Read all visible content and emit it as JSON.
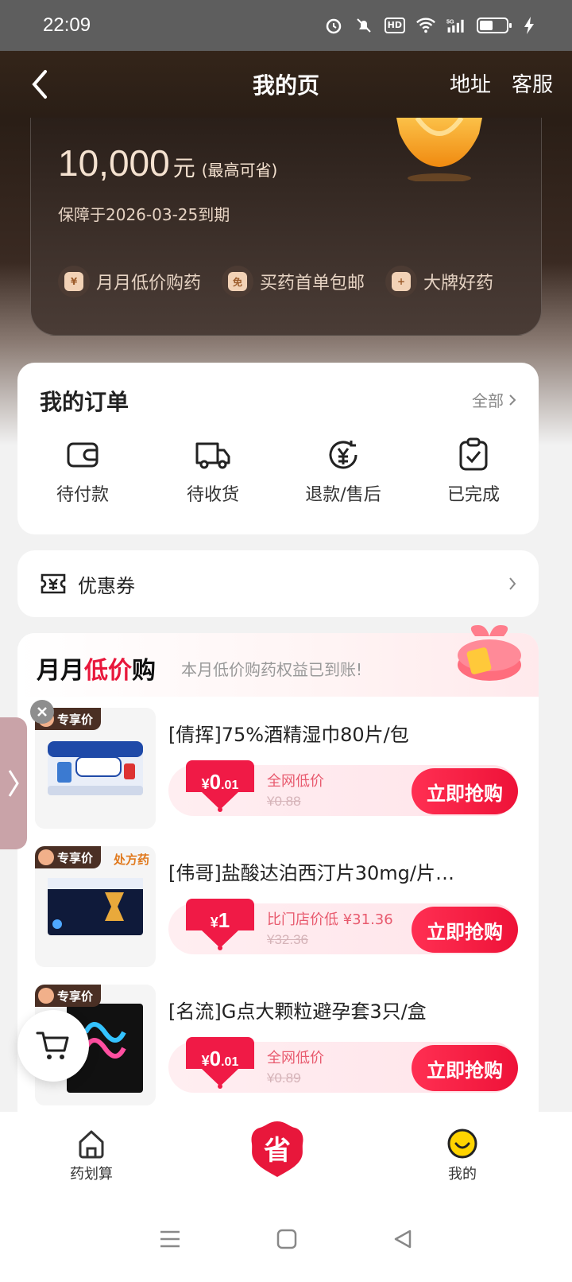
{
  "status_bar": {
    "time": "22:09",
    "hd": "HD",
    "signal": "5G"
  },
  "header": {
    "title": "我的页",
    "actions": [
      "地址",
      "客服"
    ]
  },
  "hero": {
    "amount": "10,000",
    "unit": "元",
    "amount_note": "(最高可省)",
    "expire": "保障于2026-03-25到期",
    "perks": [
      {
        "label": "月月低价购药",
        "icon": "yen-bag-icon",
        "glyph": "¥"
      },
      {
        "label": "买药首单包邮",
        "icon": "free-shipping-icon",
        "glyph": "免"
      },
      {
        "label": "大牌好药",
        "icon": "medicine-bag-icon",
        "glyph": "+"
      }
    ]
  },
  "orders": {
    "title": "我的订单",
    "all_label": "全部",
    "items": [
      {
        "label": "待付款",
        "icon": "wallet-icon"
      },
      {
        "label": "待收货",
        "icon": "truck-icon"
      },
      {
        "label": "退款/售后",
        "icon": "refund-icon"
      },
      {
        "label": "已完成",
        "icon": "clipboard-check-icon"
      }
    ]
  },
  "coupon": {
    "label": "优惠券"
  },
  "monthly": {
    "title_a": "月月",
    "title_b": "低价",
    "title_c": "购",
    "subtitle": "本月低价购药权益已到账!",
    "tag": "专享价",
    "rx_tag": "处方药",
    "products": [
      {
        "name": "[倩挥]75%酒精湿巾80片/包",
        "price_yen": "¥",
        "price_int": "0",
        "price_dec": ".01",
        "desc": "全网低价",
        "orig": "¥0.88",
        "button": "立即抢购",
        "rx": false
      },
      {
        "name": "[伟哥]盐酸达泊西汀片30mg/片…",
        "price_yen": "¥",
        "price_int": "1",
        "price_dec": "",
        "desc": "比门店价低 ¥31.36",
        "orig": "¥32.36",
        "button": "立即抢购",
        "rx": true
      },
      {
        "name": "[名流]G点大颗粒避孕套3只/盒",
        "price_yen": "¥",
        "price_int": "0",
        "price_dec": ".01",
        "desc": "全网低价",
        "orig": "¥0.89",
        "button": "立即抢购",
        "rx": false
      }
    ]
  },
  "tabbar": {
    "items": [
      {
        "label": "药划算",
        "icon": "home-icon"
      },
      {
        "label": "省",
        "icon": "save-icon"
      },
      {
        "label": "我的",
        "icon": "smiley-icon"
      }
    ]
  },
  "colors": {
    "accent": "#e8173b",
    "gold": "#f5e2d0"
  }
}
